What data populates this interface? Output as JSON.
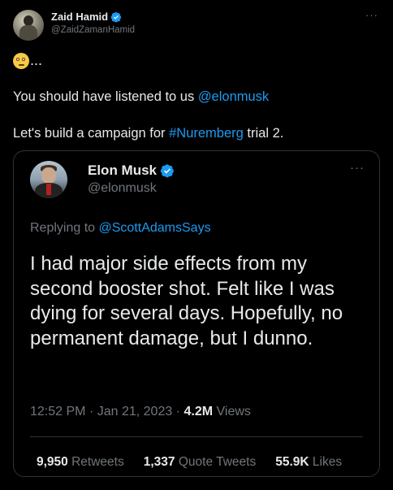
{
  "outer_tweet": {
    "author_name": "Zaid Hamid",
    "author_handle": "@ZaidZamanHamid",
    "more_label": "···",
    "emoji_suffix": "...",
    "line1_text": "You should have listened to us ",
    "line1_mention": "@elonmusk",
    "line2_text_a": "Let's build a campaign for ",
    "line2_hashtag": "#Nuremberg",
    "line2_text_b": " trial 2."
  },
  "quoted_tweet": {
    "author_name": "Elon Musk",
    "author_handle": "@elonmusk",
    "more_label": "···",
    "replying_prefix": "Replying to ",
    "replying_to": "@ScottAdamsSays",
    "body": "I had major side effects from my second booster shot. Felt like I was dying for several days. Hopefully, no permanent damage, but I dunno.",
    "time": "12:52 PM",
    "date": "Jan 21, 2023",
    "separator": "·",
    "views_count": "4.2M",
    "views_label": "Views",
    "stats": {
      "retweets_count": "9,950",
      "retweets_label": "Retweets",
      "quotes_count": "1,337",
      "quotes_label": "Quote Tweets",
      "likes_count": "55.9K",
      "likes_label": "Likes"
    }
  },
  "icons": {
    "verified": "verified-badge-icon",
    "emoji": "face-with-rolling-eyes-icon"
  },
  "colors": {
    "background": "#000000",
    "text_primary": "#e7e9ea",
    "text_secondary": "#71767b",
    "link": "#1d9bf0",
    "border": "#2f3336"
  }
}
